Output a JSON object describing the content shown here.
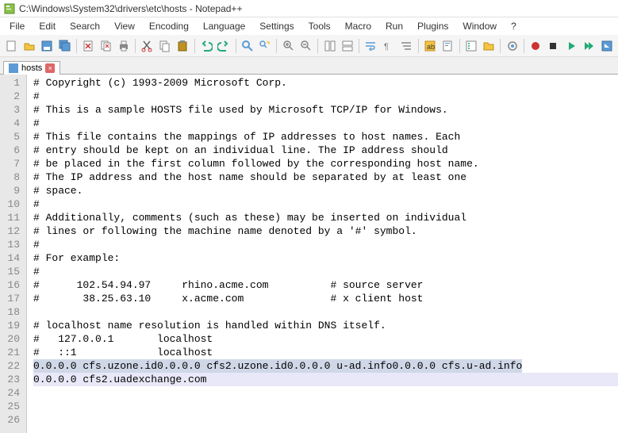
{
  "title": "C:\\Windows\\System32\\drivers\\etc\\hosts - Notepad++",
  "menus": [
    "File",
    "Edit",
    "Search",
    "View",
    "Encoding",
    "Language",
    "Settings",
    "Tools",
    "Macro",
    "Run",
    "Plugins",
    "Window",
    "?"
  ],
  "tab": {
    "label": "hosts"
  },
  "lines": [
    {
      "n": 1,
      "t": "# Copyright (c) 1993-2009 Microsoft Corp."
    },
    {
      "n": 2,
      "t": "#"
    },
    {
      "n": 3,
      "t": "# This is a sample HOSTS file used by Microsoft TCP/IP for Windows."
    },
    {
      "n": 4,
      "t": "#"
    },
    {
      "n": 5,
      "t": "# This file contains the mappings of IP addresses to host names. Each"
    },
    {
      "n": 6,
      "t": "# entry should be kept on an individual line. The IP address should"
    },
    {
      "n": 7,
      "t": "# be placed in the first column followed by the corresponding host name."
    },
    {
      "n": 8,
      "t": "# The IP address and the host name should be separated by at least one"
    },
    {
      "n": 9,
      "t": "# space."
    },
    {
      "n": 10,
      "t": "#"
    },
    {
      "n": 11,
      "t": "# Additionally, comments (such as these) may be inserted on individual"
    },
    {
      "n": 12,
      "t": "# lines or following the machine name denoted by a '#' symbol."
    },
    {
      "n": 13,
      "t": "#"
    },
    {
      "n": 14,
      "t": "# For example:"
    },
    {
      "n": 15,
      "t": "#"
    },
    {
      "n": 16,
      "t": "#      102.54.94.97     rhino.acme.com          # source server"
    },
    {
      "n": 17,
      "t": "#       38.25.63.10     x.acme.com              # x client host"
    },
    {
      "n": 18,
      "t": ""
    },
    {
      "n": 19,
      "t": "# localhost name resolution is handled within DNS itself."
    },
    {
      "n": 20,
      "t": "#   127.0.0.1       localhost"
    },
    {
      "n": 21,
      "t": "#   ::1             localhost"
    },
    {
      "n": 22,
      "t": "0.0.0.0 cfs.uzone.id",
      "sel": true
    },
    {
      "n": 23,
      "t": "0.0.0.0 cfs2.uzone.id",
      "sel": true
    },
    {
      "n": 24,
      "t": "0.0.0.0 u-ad.info",
      "sel": true
    },
    {
      "n": 25,
      "t": "0.0.0.0 cfs.u-ad.info",
      "sel": true
    },
    {
      "n": 26,
      "t": "0.0.0.0 cfs2.uadexchange.com",
      "cursor": true
    }
  ],
  "toolbar_icons": [
    "new-icon",
    "open-icon",
    "save-icon",
    "save-all-icon",
    "sep",
    "close-icon",
    "close-all-icon",
    "print-icon",
    "sep",
    "cut-icon",
    "copy-icon",
    "paste-icon",
    "sep",
    "undo-icon",
    "redo-icon",
    "sep",
    "find-icon",
    "replace-icon",
    "sep",
    "zoom-in-icon",
    "zoom-out-icon",
    "sep",
    "sync-v-icon",
    "sync-h-icon",
    "sep",
    "wordwrap-icon",
    "all-chars-icon",
    "indent-guide-icon",
    "sep",
    "lang-icon",
    "doc-map-icon",
    "sep",
    "func-list-icon",
    "folder-icon",
    "sep",
    "monitor-icon",
    "sep",
    "record-icon",
    "stop-icon",
    "play-icon",
    "play-multi-icon",
    "save-macro-icon"
  ]
}
